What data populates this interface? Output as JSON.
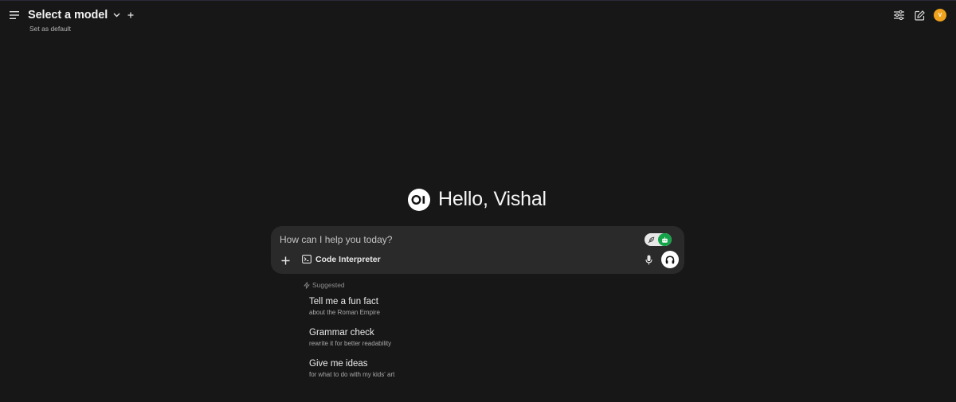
{
  "header": {
    "model_title": "Select a model",
    "set_default": "Set as default",
    "avatar_initial": "V"
  },
  "greeting": {
    "logo_text": "OI",
    "text": "Hello, Vishal"
  },
  "chat": {
    "placeholder": "How can I help you today?",
    "value": "",
    "tool_label": "Code Interpreter"
  },
  "suggestions": {
    "heading": "Suggested",
    "items": [
      {
        "title": "Tell me a fun fact",
        "subtitle": "about the Roman Empire"
      },
      {
        "title": "Grammar check",
        "subtitle": "rewrite it for better readability"
      },
      {
        "title": "Give me ideas",
        "subtitle": "for what to do with my kids' art"
      }
    ]
  },
  "colors": {
    "background": "#171717",
    "input_bg": "#2a2a2a",
    "avatar": "#f0a21c",
    "toggle_active": "#15a34a"
  },
  "icons": [
    "menu-icon",
    "chevron-down-icon",
    "plus-icon",
    "sliders-icon",
    "edit-icon",
    "feather-icon",
    "robot-icon",
    "terminal-icon",
    "mic-icon",
    "headphones-icon",
    "bolt-icon"
  ]
}
